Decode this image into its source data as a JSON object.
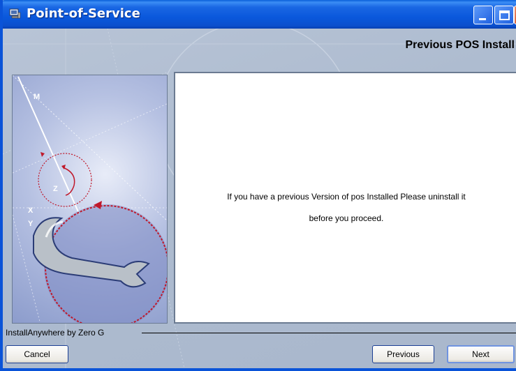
{
  "window": {
    "title": "Point-of-Service",
    "controls": {
      "minimize": "minimize-icon",
      "maximize": "maximize-icon",
      "close": "close-icon"
    }
  },
  "header": {
    "heading": "Previous POS Install"
  },
  "message": {
    "line1": "If you have a previous Version of  pos Installed Please uninstall it",
    "line2": "before you proceed."
  },
  "footer": {
    "brand": "InstallAnywhere by Zero G"
  },
  "buttons": {
    "cancel": "Cancel",
    "previous": "Previous",
    "next": "Next"
  },
  "graphic_labels": {
    "m": "M",
    "z": "Z",
    "x": "X",
    "y": "Y"
  },
  "colors": {
    "titlebar": "#0a58dc",
    "content_bg": "#a9b7cc",
    "accent_red": "#c0182a"
  }
}
